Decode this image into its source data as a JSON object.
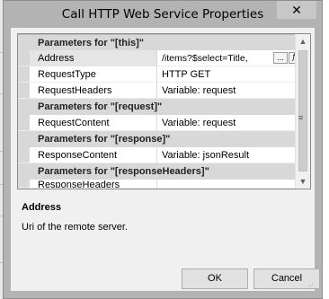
{
  "window": {
    "title": "Call HTTP Web Service Properties",
    "close_glyph": "✕"
  },
  "grid": {
    "categories": [
      "Parameters for \"[this]\"",
      "Parameters for \"[request]\"",
      "Parameters for \"[response]\"",
      "Parameters for \"[responseHeaders]\""
    ],
    "properties": [
      {
        "name": "Address",
        "value": "/items?$select=Title,Bo"
      },
      {
        "name": "RequestType",
        "value": "HTTP GET"
      },
      {
        "name": "RequestHeaders",
        "value": "Variable: request"
      },
      {
        "name": "RequestContent",
        "value": "Variable: request"
      },
      {
        "name": "ResponseContent",
        "value": "Variable: jsonResult"
      },
      {
        "name": "ResponseHeaders",
        "value": ""
      }
    ],
    "ellipsis_label": "...",
    "fx_label": "fx",
    "scroll_up_glyph": "▲",
    "scroll_down_glyph": "▼",
    "scroll_grip_glyph": "≡"
  },
  "description": {
    "title": "Address",
    "text": "Uri of the remote server."
  },
  "buttons": {
    "ok": "OK",
    "cancel": "Cancel"
  },
  "resize_glyph": "⋰"
}
